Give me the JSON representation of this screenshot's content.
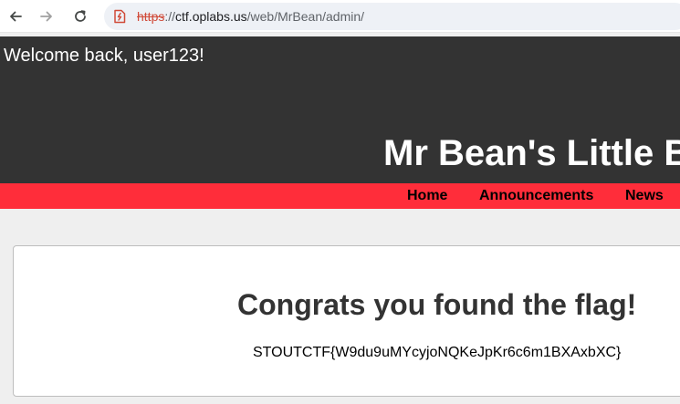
{
  "browser": {
    "url": {
      "scheme": "https",
      "separator": "://",
      "host": "ctf.oplabs.us",
      "path": "/web/MrBean/admin/"
    },
    "icons": {
      "back": "arrow-left-icon",
      "forward": "arrow-right-icon",
      "reload": "reload-icon",
      "security": "not-secure-icon"
    }
  },
  "header": {
    "welcome": "Welcome back, user123!",
    "title": "Mr Bean's Little Blog"
  },
  "nav": {
    "items": [
      {
        "label": "Home"
      },
      {
        "label": "Announcements"
      },
      {
        "label": "News"
      }
    ]
  },
  "content": {
    "heading": "Congrats you found the flag!",
    "flag": "STOUTCTF{W9du9uMYcyjoNQKeJpKr6c6m1BXAxbXC}"
  },
  "colors": {
    "header_bg": "#333333",
    "nav_bg": "#ff2d3a",
    "page_bg": "#efefef",
    "warning": "#d04a38"
  }
}
